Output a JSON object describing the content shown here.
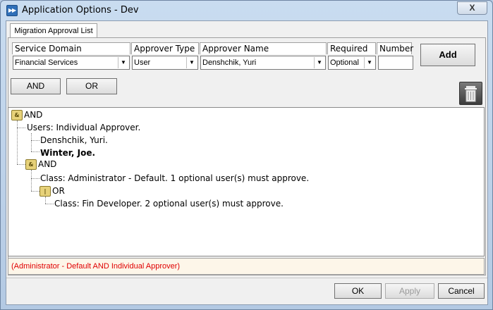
{
  "window": {
    "title": "Application Options - Dev",
    "close_label": "X",
    "icon": "app-icon"
  },
  "tabs": [
    {
      "label": "Migration Approval List"
    }
  ],
  "columns": {
    "service_domain": "Service Domain",
    "approver_type": "Approver Type",
    "approver_name": "Approver Name",
    "required": "Required",
    "number": "Number"
  },
  "fields": {
    "service_domain": "Financial Services",
    "approver_type": "User",
    "approver_name": "Denshchik, Yuri",
    "required": "Optional",
    "number": ""
  },
  "buttons": {
    "add": "Add",
    "and": "AND",
    "or": "OR",
    "ok": "OK",
    "apply": "Apply",
    "cancel": "Cancel"
  },
  "tree": {
    "root": "AND",
    "users": "Users: Individual Approver.",
    "user1": "Denshchik, Yuri.",
    "user2": "Winter, Joe.",
    "and2": "AND",
    "class1": "Class: Administrator - Default. 1 optional user(s) must approve.",
    "or1": "OR",
    "class2": "Class: Fin Developer. 2 optional user(s) must approve."
  },
  "status": "(Administrator - Default AND Individual Approver)",
  "colors": {
    "status_text": "#e00000",
    "status_bg": "#fdf6e9"
  }
}
